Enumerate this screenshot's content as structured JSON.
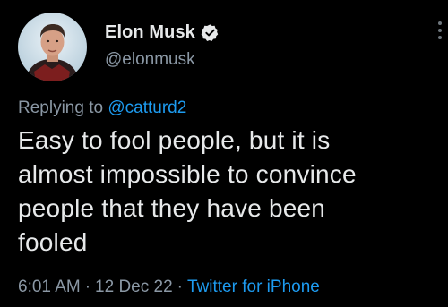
{
  "author": {
    "display_name": "Elon Musk",
    "handle": "@elonmusk",
    "avatar_icon": "profile-photo",
    "verified_icon": "verified-badge-icon",
    "verified_color": "#1d9bf0"
  },
  "reply": {
    "prefix": "Replying to",
    "to_handle": "@catturd2"
  },
  "tweet": {
    "text_lines": [
      "Easy to fool people, but it is",
      "almost impossible to convince",
      "people that they have been",
      "fooled"
    ]
  },
  "meta": {
    "time": "6:01 AM",
    "separator": "·",
    "date": "12 Dec 22",
    "source": "Twitter for iPhone"
  },
  "colors": {
    "background": "#000000",
    "text": "#e7e9ea",
    "secondary": "#8b98a5",
    "accent": "#1d9bf0"
  }
}
